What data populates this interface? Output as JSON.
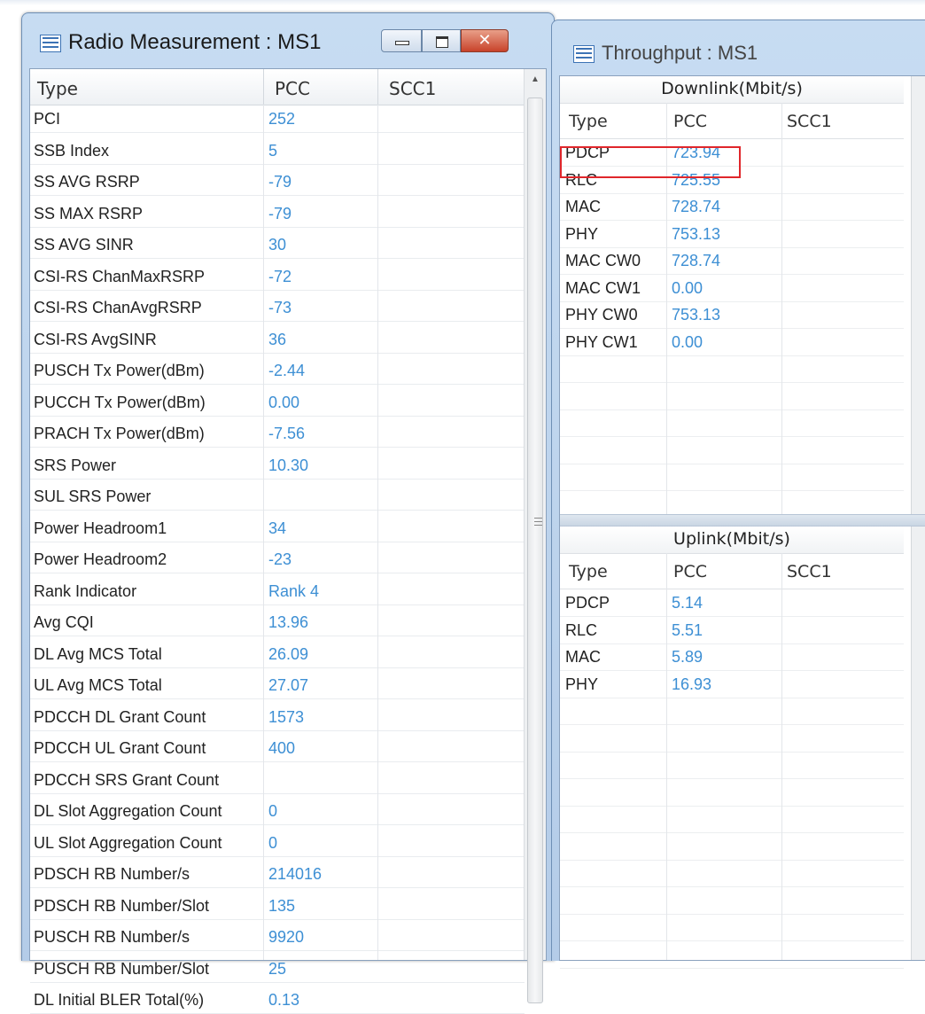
{
  "radio_window": {
    "title": "Radio Measurement : MS1",
    "columns": [
      "Type",
      "PCC",
      "SCC1"
    ],
    "rows": [
      {
        "type": "PCI",
        "pcc": "252",
        "scc1": ""
      },
      {
        "type": "SSB Index",
        "pcc": "5",
        "scc1": ""
      },
      {
        "type": "SS AVG RSRP",
        "pcc": "-79",
        "scc1": ""
      },
      {
        "type": "SS MAX RSRP",
        "pcc": "-79",
        "scc1": ""
      },
      {
        "type": "SS AVG SINR",
        "pcc": "30",
        "scc1": ""
      },
      {
        "type": "CSI-RS ChanMaxRSRP",
        "pcc": "-72",
        "scc1": ""
      },
      {
        "type": "CSI-RS ChanAvgRSRP",
        "pcc": "-73",
        "scc1": ""
      },
      {
        "type": "CSI-RS AvgSINR",
        "pcc": "36",
        "scc1": ""
      },
      {
        "type": "PUSCH Tx Power(dBm)",
        "pcc": "-2.44",
        "scc1": ""
      },
      {
        "type": "PUCCH Tx Power(dBm)",
        "pcc": "0.00",
        "scc1": ""
      },
      {
        "type": "PRACH Tx Power(dBm)",
        "pcc": "-7.56",
        "scc1": ""
      },
      {
        "type": "SRS Power",
        "pcc": "10.30",
        "scc1": ""
      },
      {
        "type": "SUL SRS Power",
        "pcc": "",
        "scc1": ""
      },
      {
        "type": "Power Headroom1",
        "pcc": "34",
        "scc1": ""
      },
      {
        "type": "Power Headroom2",
        "pcc": "-23",
        "scc1": ""
      },
      {
        "type": "Rank Indicator",
        "pcc": "Rank 4",
        "scc1": ""
      },
      {
        "type": "Avg CQI",
        "pcc": "13.96",
        "scc1": ""
      },
      {
        "type": "DL Avg MCS Total",
        "pcc": "26.09",
        "scc1": ""
      },
      {
        "type": "UL Avg MCS Total",
        "pcc": "27.07",
        "scc1": ""
      },
      {
        "type": "PDCCH DL Grant Count",
        "pcc": "1573",
        "scc1": ""
      },
      {
        "type": "PDCCH UL Grant Count",
        "pcc": "400",
        "scc1": ""
      },
      {
        "type": "PDCCH SRS Grant Count",
        "pcc": "",
        "scc1": ""
      },
      {
        "type": "DL Slot Aggregation Count",
        "pcc": "0",
        "scc1": ""
      },
      {
        "type": "UL Slot Aggregation Count",
        "pcc": "0",
        "scc1": ""
      },
      {
        "type": "PDSCH RB Number/s",
        "pcc": "214016",
        "scc1": ""
      },
      {
        "type": "PDSCH RB Number/Slot",
        "pcc": "135",
        "scc1": ""
      },
      {
        "type": "PUSCH RB Number/s",
        "pcc": "9920",
        "scc1": ""
      },
      {
        "type": "PUSCH RB Number/Slot",
        "pcc": "25",
        "scc1": ""
      },
      {
        "type": "DL Initial BLER Total(%)",
        "pcc": "0.13",
        "scc1": ""
      }
    ]
  },
  "throughput_window": {
    "title": "Throughput : MS1",
    "downlink": {
      "title": "Downlink(Mbit/s)",
      "columns": [
        "Type",
        "PCC",
        "SCC1"
      ],
      "rows": [
        {
          "type": "PDCP",
          "pcc": "723.94"
        },
        {
          "type": "RLC",
          "pcc": "725.55"
        },
        {
          "type": "MAC",
          "pcc": "728.74"
        },
        {
          "type": "PHY",
          "pcc": "753.13"
        },
        {
          "type": "MAC CW0",
          "pcc": "728.74"
        },
        {
          "type": "MAC CW1",
          "pcc": "0.00"
        },
        {
          "type": "PHY CW0",
          "pcc": "753.13"
        },
        {
          "type": "PHY CW1",
          "pcc": "0.00"
        }
      ]
    },
    "uplink": {
      "title": "Uplink(Mbit/s)",
      "columns": [
        "Type",
        "PCC",
        "SCC1"
      ],
      "rows": [
        {
          "type": "PDCP",
          "pcc": "5.14"
        },
        {
          "type": "RLC",
          "pcc": "5.51"
        },
        {
          "type": "MAC",
          "pcc": "5.89"
        },
        {
          "type": "PHY",
          "pcc": "16.93"
        }
      ]
    }
  },
  "colors": {
    "value_text": "#3d8fd4",
    "highlight_box": "#e0262b",
    "title_bar": "#c7dcf2"
  },
  "icons": {
    "window_icon": "table-icon",
    "minimize": "minimize-icon",
    "maximize": "maximize-icon",
    "close": "close-icon",
    "scroll_up": "scroll-up-arrow-icon",
    "scroll_grip": "scroll-grip-icon"
  }
}
